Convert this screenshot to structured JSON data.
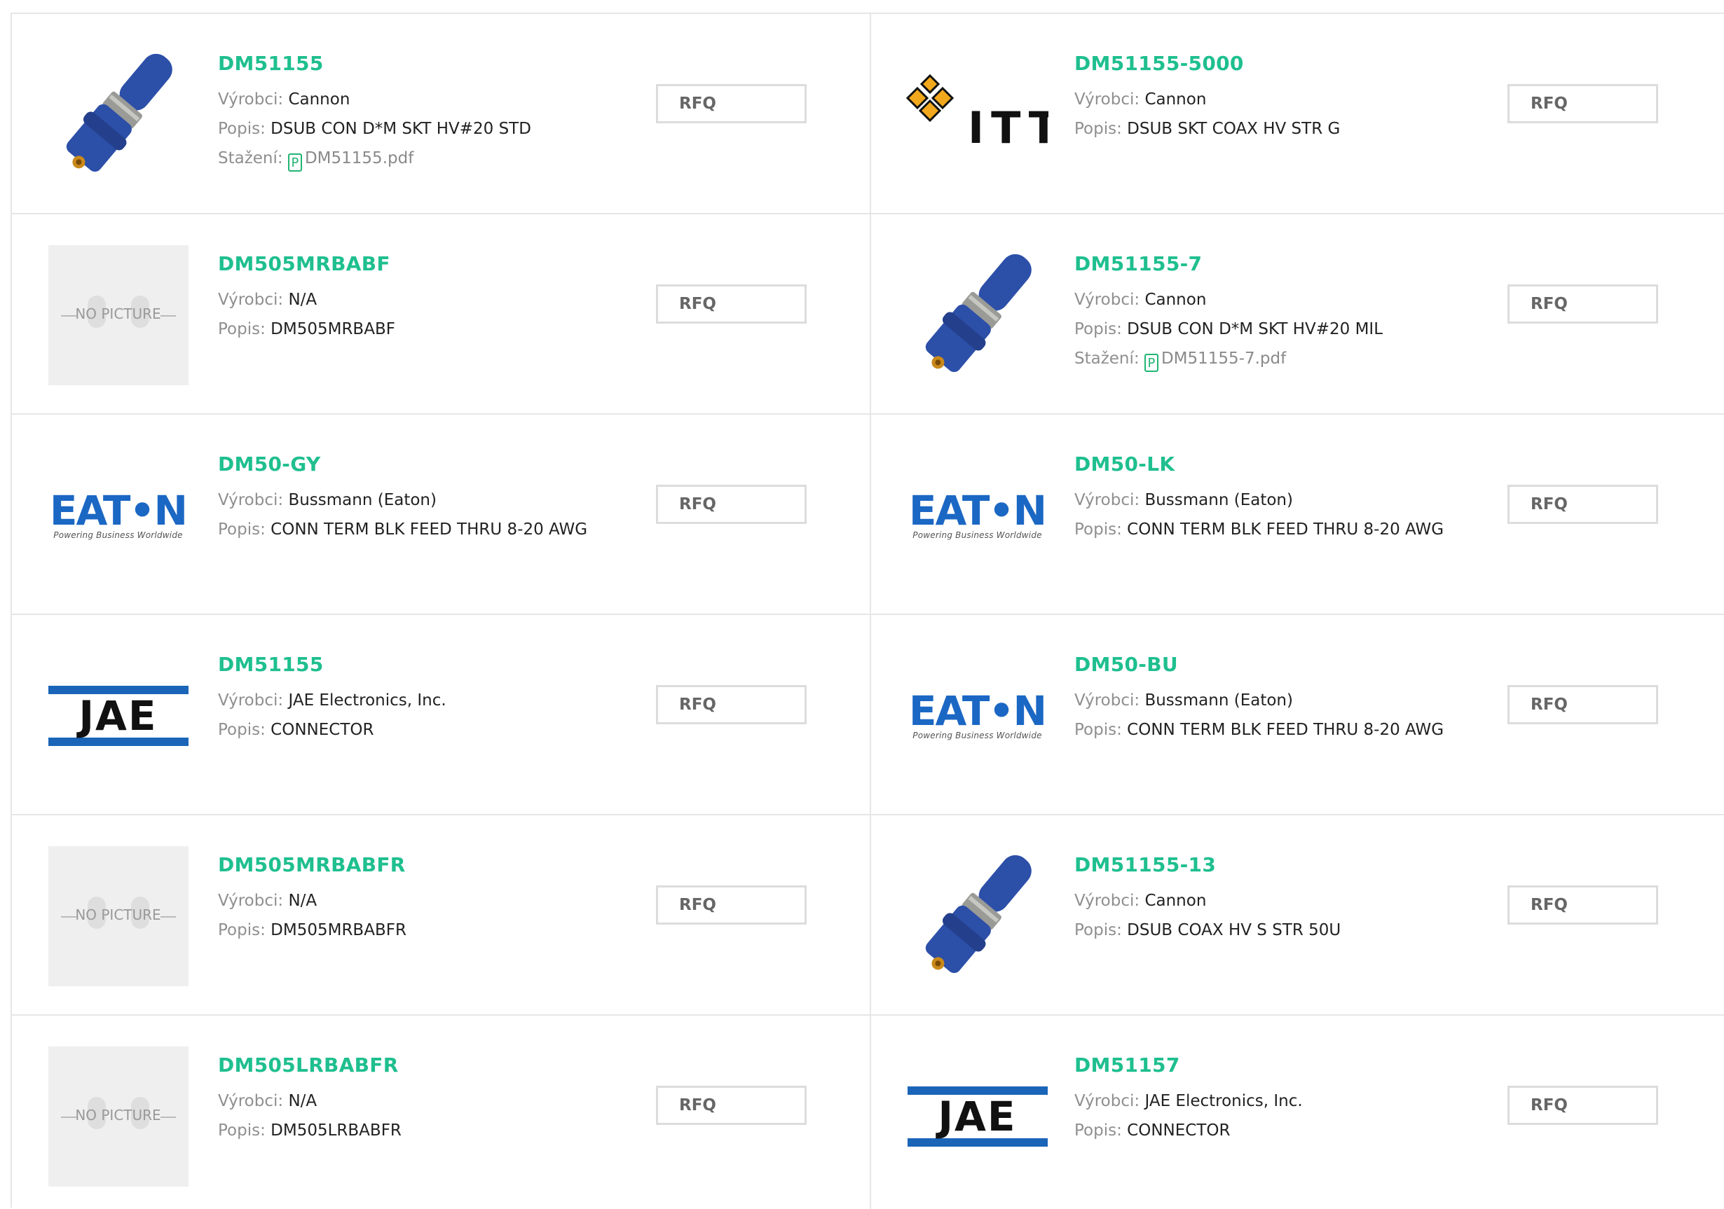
{
  "labels": {
    "manufacturer": "Výrobci: ",
    "description": "Popis: ",
    "download": "Stažení: ",
    "rfq": "RFQ",
    "no_picture": "NO PICTURE"
  },
  "products": [
    {
      "part": "DM51155",
      "manufacturer": "Cannon",
      "description": "DSUB CON D*M SKT HV#20 STD",
      "download": "DM51155.pdf",
      "image": "connector-image"
    },
    {
      "part": "DM51155-5000",
      "manufacturer": "Cannon",
      "description": "DSUB SKT COAX HV STR G",
      "image": "itt-logo"
    },
    {
      "part": "DM505MRBABF",
      "manufacturer": "N/A",
      "description": "DM505MRBABF",
      "image": "no-picture"
    },
    {
      "part": "DM51155-7",
      "manufacturer": "Cannon",
      "description": "DSUB CON D*M SKT HV#20 MIL",
      "download": "DM51155-7.pdf",
      "image": "connector-image"
    },
    {
      "part": "DM50-GY",
      "manufacturer": "Bussmann (Eaton)",
      "description": "CONN TERM BLK FEED THRU 8-20 AWG",
      "image": "eaton-logo"
    },
    {
      "part": "DM50-LK",
      "manufacturer": "Bussmann (Eaton)",
      "description": "CONN TERM BLK FEED THRU 8-20 AWG",
      "image": "eaton-logo"
    },
    {
      "part": "DM51155",
      "manufacturer": "JAE Electronics, Inc.",
      "description": "CONNECTOR",
      "image": "jae-logo"
    },
    {
      "part": "DM50-BU",
      "manufacturer": "Bussmann (Eaton)",
      "description": "CONN TERM BLK FEED THRU 8-20 AWG",
      "image": "eaton-logo"
    },
    {
      "part": "DM505MRBABFR",
      "manufacturer": "N/A",
      "description": "DM505MRBABFR",
      "image": "no-picture"
    },
    {
      "part": "DM51155-13",
      "manufacturer": "Cannon",
      "description": "DSUB COAX HV S STR 50U",
      "image": "connector-image"
    },
    {
      "part": "DM505LRBABFR",
      "manufacturer": "N/A",
      "description": "DM505LRBABFR",
      "image": "no-picture"
    },
    {
      "part": "DM51157",
      "manufacturer": "JAE Electronics, Inc.",
      "description": "CONNECTOR",
      "image": "jae-logo"
    }
  ],
  "logos": {
    "eaton_word": "EAT•N",
    "eaton_tagline": "Powering Business Worldwide",
    "jae_word": "JAE",
    "itt_word": "ITT"
  },
  "colors": {
    "part_link": "#1fbf8f",
    "pdf_icon": "#22b573",
    "eaton_blue": "#1b67c4",
    "jae_blue": "#1b65b8",
    "connector_blue": "#2c4fa8",
    "itt_orange": "#f2a81d"
  }
}
